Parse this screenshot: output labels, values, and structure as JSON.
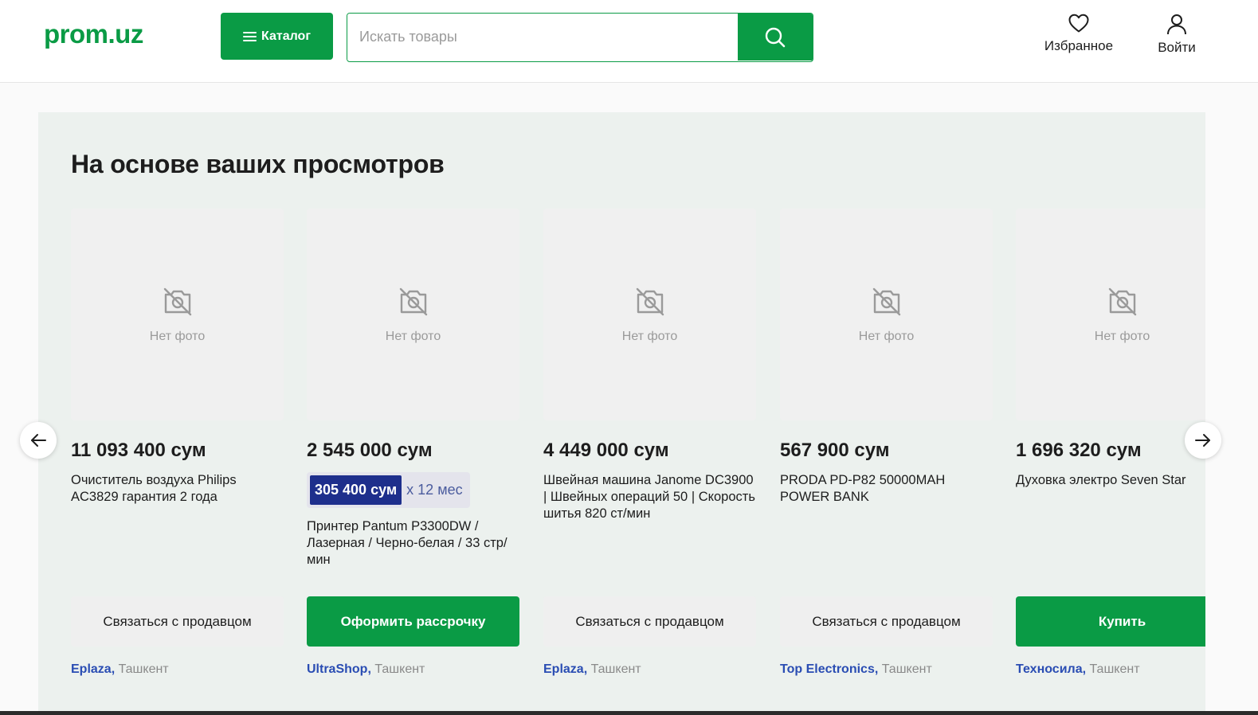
{
  "header": {
    "logo": "prom.uz",
    "catalog_label": "Каталог",
    "search_placeholder": "Искать товары",
    "favorites_label": "Избранное",
    "login_label": "Войти"
  },
  "section": {
    "title": "На основе ваших просмотров"
  },
  "no_photo_label": "Нет фото",
  "products": [
    {
      "price": "11 093 400 сум",
      "title": "Очиститель воздуха Philips AC3829 гарантия 2 года",
      "button": "Связаться с продавцом",
      "seller": "Eplaza,",
      "city": "Ташкент"
    },
    {
      "price": "2 545 000 сум",
      "installment_amount": "305 400 сум",
      "installment_term": "x 12 мес",
      "title": "Принтер Pantum P3300DW / Лазерная / Черно-белая / 33 стр/мин",
      "button": "Оформить рассрочку",
      "seller": "UltraShop,",
      "city": "Ташкент"
    },
    {
      "price": "4 449 000 сум",
      "title": "Швейная машина Janome DC3900 | Швейных операций 50 | Скорость шитья 820 ст/мин",
      "button": "Связаться с продавцом",
      "seller": "Eplaza,",
      "city": "Ташкент"
    },
    {
      "price": "567 900 сум",
      "title": "PRODA PD-P82 50000MAH POWER BANK",
      "button": "Связаться с продавцом",
      "seller": "Top Electronics,",
      "city": "Ташкент"
    },
    {
      "price": "1 696 320 сум",
      "title": "Духовка электро Seven Star",
      "button": "Купить",
      "seller": "Техносила,",
      "city": "Ташкент"
    }
  ],
  "colors": {
    "brand_green": "#0a9b45",
    "installment_blue": "#1e2f8c",
    "seller_link": "#2a4db3",
    "section_bg": "#ecf1ee"
  }
}
